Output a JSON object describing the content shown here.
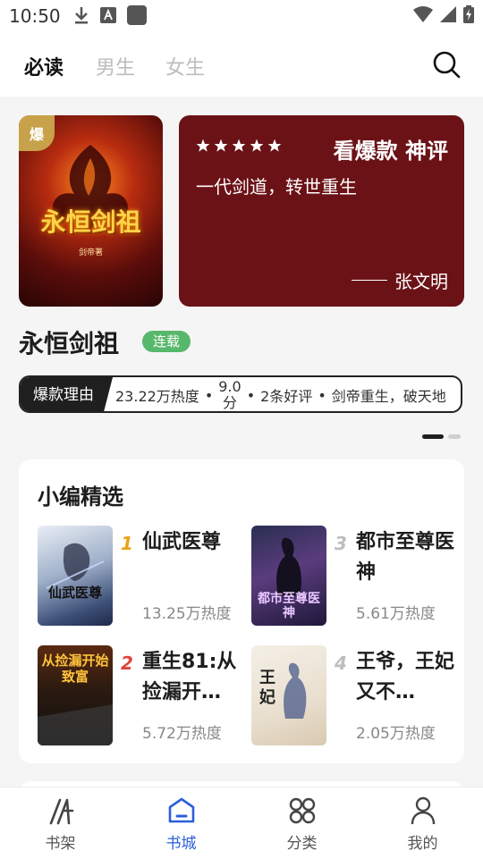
{
  "status_bar": {
    "time": "10:50"
  },
  "top_tabs": [
    {
      "label": "必读",
      "active": true
    },
    {
      "label": "男生",
      "active": false
    },
    {
      "label": "女生",
      "active": false
    }
  ],
  "featured": {
    "cover_badge": "爆",
    "cover_title": "永恒剑祖",
    "cover_author": "剑帝著",
    "review": {
      "rating_stars": 5,
      "heading": "看爆款 神评",
      "quote": "一代剑道，转世重生",
      "author": "张文明"
    },
    "title": "永恒剑祖",
    "status": "连载",
    "reason_label": "爆款理由",
    "reason_heat": "23.22万热度",
    "reason_score_num": "9.0",
    "reason_score_unit": "分",
    "reason_reviews": "2条好评",
    "reason_tagline": "剑帝重生，破天地",
    "reason_sep": "•"
  },
  "pager": {
    "total": 2,
    "active": 1
  },
  "editor_picks": {
    "title": "小编精选",
    "items": [
      {
        "rank": "1",
        "name": "仙武医尊",
        "heat": "13.25万热度",
        "cover_text": "仙武医尊"
      },
      {
        "rank": "3",
        "name": "都市至尊医神",
        "heat": "5.61万热度",
        "cover_text": "都市至尊医神"
      },
      {
        "rank": "2",
        "name": "重生81:从捡漏开…",
        "heat": "5.72万热度",
        "cover_text": "从捡漏开始致富"
      },
      {
        "rank": "4",
        "name": "王爷，王妃又不…",
        "heat": "2.05万热度",
        "cover_text": "王妃"
      }
    ]
  },
  "bottom_nav": [
    {
      "label": "书架",
      "icon": "bookshelf-icon",
      "active": false
    },
    {
      "label": "书城",
      "icon": "bookstore-icon",
      "active": true
    },
    {
      "label": "分类",
      "icon": "category-icon",
      "active": false
    },
    {
      "label": "我的",
      "icon": "profile-icon",
      "active": false
    }
  ],
  "colors": {
    "review_bg": "#6b1217",
    "status_tag": "#57b86b",
    "active_nav": "#2b5fd9",
    "rank_1": "#e8a317",
    "rank_2": "#e2463b",
    "rank_3": "#bdbdbd",
    "rank_4": "#bdbdbd"
  }
}
